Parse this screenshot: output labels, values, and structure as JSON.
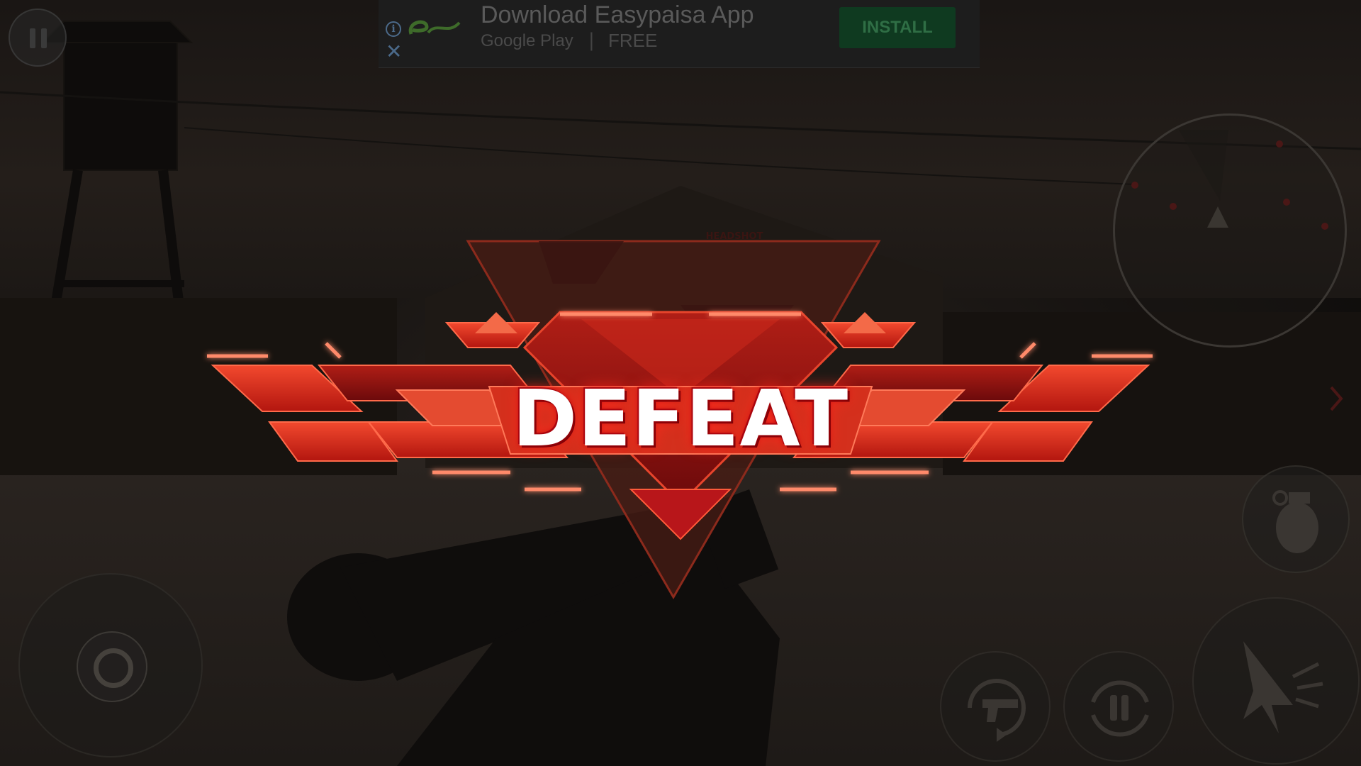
{
  "ad": {
    "headline": "Download Easypaisa App",
    "store": "Google Play",
    "separator": "|",
    "price": "FREE",
    "install_label": "INSTALL",
    "info_glyph": "i",
    "close_glyph": "✕"
  },
  "result": {
    "title": "DEFEAT"
  },
  "scene_text": {
    "headshot": "HEADSHOT"
  },
  "icons": {
    "pause": "pause-icon",
    "grenade": "grenade-icon",
    "reload": "reload-pistol-icon",
    "swap": "swap-ammo-icon",
    "fire": "fire-icon",
    "minimap_player": "player-marker-icon",
    "edge": "chevron-right-icon"
  },
  "colors": {
    "badge_primary": "#e0341f",
    "badge_dark": "#8c0f10",
    "badge_glow": "#ff5a3a",
    "minimap_enemy": "#c0262b",
    "ad_install_bg": "#0f3a20"
  }
}
